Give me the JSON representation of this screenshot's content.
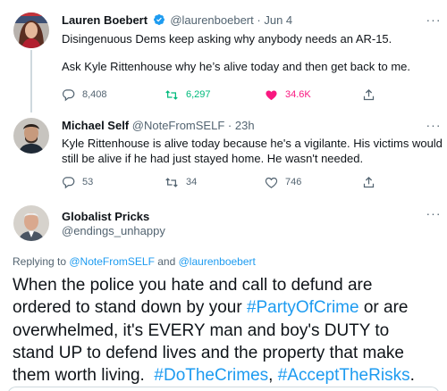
{
  "tweet1": {
    "name": "Lauren Boebert",
    "handle": "@laurenboebert",
    "dot": "·",
    "time": "Jun 4",
    "line1": "Disingenuous Dems keep asking why anybody needs an AR-15.",
    "line2": "Ask Kyle Rittenhouse why he’s alive today and then get back to me.",
    "replies": "8,408",
    "retweets": "6,297",
    "likes": "34.6K"
  },
  "tweet2": {
    "name": "Michael Self",
    "handle": "@NoteFromSELF",
    "dot": "·",
    "time": "23h",
    "line1": "Kyle Rittenhouse is alive today because he's a vigilante. His victims would",
    "line2": "still be alive if he had just stayed home. He wasn't needed.",
    "replies": "53",
    "retweets": "34",
    "likes": "746"
  },
  "tweet3": {
    "name": "Globalist Pricks",
    "handle": "@endings_unhappy",
    "replying_prefix": "Replying to ",
    "replying_user1": "@NoteFromSELF",
    "replying_and": " and ",
    "replying_user2": "@laurenboebert",
    "line1": "When the police you hate and call to defund are",
    "line2_a": "ordered to stand down by your ",
    "line2_tag": "#PartyOfCrime",
    "line2_b": " or are",
    "line3": "overwhelmed, it's EVERY man and boy's DUTY to",
    "line4": "stand UP to defend lives and the property that make",
    "line5_a": "them worth living.  ",
    "line5_tag1": "#DoTheCrimes",
    "line5_sep": ", ",
    "line5_tag2": "#AcceptTheRisks",
    "line5_end": "."
  },
  "colors": {
    "accent": "#1d9bf0",
    "retweet": "#00ba7c",
    "like": "#f91880",
    "secondary_text": "#536471"
  },
  "icons": [
    "verified-badge-icon",
    "reply-icon",
    "retweet-icon",
    "like-icon",
    "share-icon",
    "more-icon"
  ]
}
